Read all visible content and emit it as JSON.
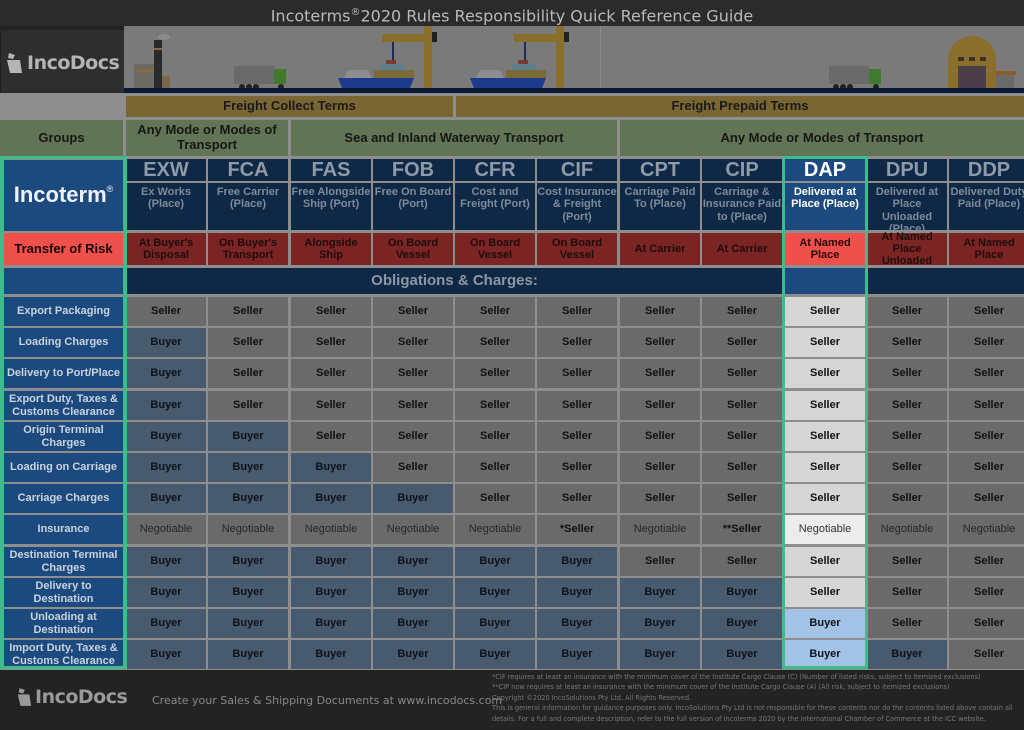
{
  "title": {
    "prefix": "Incoterms",
    "reg": "®",
    "suffix": "2020 Rules Responsibility Quick Reference Guide"
  },
  "brand": {
    "name": "IncoDocs"
  },
  "freight_terms": [
    "Freight Collect Terms",
    "Freight Prepaid Terms"
  ],
  "groups_label": "Groups",
  "transport_modes": [
    "Any Mode or Modes of Transport",
    "Sea and Inland Waterway Transport",
    "Any Mode or Modes of Transport"
  ],
  "incoterm_label": "Incoterm",
  "incoterm_reg": "®",
  "risk_label": "Transfer of Risk",
  "obligations_label": "Obligations & Charges:",
  "highlighted_term": "DAP",
  "terms": [
    {
      "code": "EXW",
      "desc": "Ex Works (Place)",
      "risk": "At Buyer's Disposal"
    },
    {
      "code": "FCA",
      "desc": "Free Carrier (Place)",
      "risk": "On Buyer's Transport"
    },
    {
      "code": "FAS",
      "desc": "Free Alongside Ship (Port)",
      "risk": "Alongside Ship"
    },
    {
      "code": "FOB",
      "desc": "Free On Board (Port)",
      "risk": "On Board Vessel"
    },
    {
      "code": "CFR",
      "desc": "Cost and Freight (Port)",
      "risk": "On Board Vessel"
    },
    {
      "code": "CIF",
      "desc": "Cost Insurance & Freight (Port)",
      "risk": "On Board Vessel"
    },
    {
      "code": "CPT",
      "desc": "Carriage Paid To (Place)",
      "risk": "At Carrier"
    },
    {
      "code": "CIP",
      "desc": "Carriage & Insurance Paid to (Place)",
      "risk": "At Carrier"
    },
    {
      "code": "DAP",
      "desc": "Delivered at Place (Place)",
      "risk": "At Named Place"
    },
    {
      "code": "DPU",
      "desc": "Delivered at Place Unloaded (Place)",
      "risk": "At Named Place Unloaded"
    },
    {
      "code": "DDP",
      "desc": "Delivered Duty Paid (Place)",
      "risk": "At Named Place"
    }
  ],
  "obligations": [
    {
      "label": "Export Packaging",
      "values": [
        "Seller",
        "Seller",
        "Seller",
        "Seller",
        "Seller",
        "Seller",
        "Seller",
        "Seller",
        "Seller",
        "Seller",
        "Seller"
      ]
    },
    {
      "label": "Loading Charges",
      "values": [
        "Buyer",
        "Seller",
        "Seller",
        "Seller",
        "Seller",
        "Seller",
        "Seller",
        "Seller",
        "Seller",
        "Seller",
        "Seller"
      ]
    },
    {
      "label": "Delivery to Port/Place",
      "values": [
        "Buyer",
        "Seller",
        "Seller",
        "Seller",
        "Seller",
        "Seller",
        "Seller",
        "Seller",
        "Seller",
        "Seller",
        "Seller"
      ]
    },
    {
      "label": "Export Duty, Taxes & Customs Clearance",
      "values": [
        "Buyer",
        "Seller",
        "Seller",
        "Seller",
        "Seller",
        "Seller",
        "Seller",
        "Seller",
        "Seller",
        "Seller",
        "Seller"
      ]
    },
    {
      "label": "Origin Terminal Charges",
      "values": [
        "Buyer",
        "Buyer",
        "Seller",
        "Seller",
        "Seller",
        "Seller",
        "Seller",
        "Seller",
        "Seller",
        "Seller",
        "Seller"
      ]
    },
    {
      "label": "Loading on Carriage",
      "values": [
        "Buyer",
        "Buyer",
        "Buyer",
        "Seller",
        "Seller",
        "Seller",
        "Seller",
        "Seller",
        "Seller",
        "Seller",
        "Seller"
      ]
    },
    {
      "label": "Carriage Charges",
      "values": [
        "Buyer",
        "Buyer",
        "Buyer",
        "Buyer",
        "Seller",
        "Seller",
        "Seller",
        "Seller",
        "Seller",
        "Seller",
        "Seller"
      ]
    },
    {
      "label": "Insurance",
      "values": [
        "Negotiable",
        "Negotiable",
        "Negotiable",
        "Negotiable",
        "Negotiable",
        "*Seller",
        "Negotiable",
        "**Seller",
        "Negotiable",
        "Negotiable",
        "Negotiable"
      ]
    },
    {
      "label": "Destination Terminal Charges",
      "values": [
        "Buyer",
        "Buyer",
        "Buyer",
        "Buyer",
        "Buyer",
        "Buyer",
        "Seller",
        "Seller",
        "Seller",
        "Seller",
        "Seller"
      ]
    },
    {
      "label": "Delivery to Destination",
      "values": [
        "Buyer",
        "Buyer",
        "Buyer",
        "Buyer",
        "Buyer",
        "Buyer",
        "Buyer",
        "Buyer",
        "Seller",
        "Seller",
        "Seller"
      ]
    },
    {
      "label": "Unloading at Destination",
      "values": [
        "Buyer",
        "Buyer",
        "Buyer",
        "Buyer",
        "Buyer",
        "Buyer",
        "Buyer",
        "Buyer",
        "Buyer",
        "Seller",
        "Seller"
      ]
    },
    {
      "label": "Import Duty, Taxes & Customs Clearance",
      "values": [
        "Buyer",
        "Buyer",
        "Buyer",
        "Buyer",
        "Buyer",
        "Buyer",
        "Buyer",
        "Buyer",
        "Buyer",
        "Buyer",
        "Seller"
      ]
    }
  ],
  "footer": {
    "brand": "IncoDocs",
    "tagline": "Create your Sales & Shipping Documents at www.incodocs.com",
    "notes": [
      "*CIF requires at least an insurance with the minimum cover of the Institute Cargo Clause (C) (Number of listed risks, subject to itemized exclusions)",
      "**CIP now requires at least an insurance with the minimum cover of the Institute Cargo Clause (A) (All risk, subject to itemized exclusions)",
      "Copyright ©2020 IncoSolutions Pty Ltd. All Rights Reserved.",
      "This is general information for guidance purposes only.  IncoSolutions Pty Ltd is not responsible for these contents nor do the contents listed above contain all",
      "details.  For a full and complete description, refer to the full version of Incoterms    2020 by the International Chamber of Commerce at the ICC website."
    ]
  },
  "illustrations": [
    "factory-icon",
    "truck-icon",
    "ship-crane-icon",
    "ship-crane-icon",
    "truck-icon",
    "warehouse-icon"
  ]
}
